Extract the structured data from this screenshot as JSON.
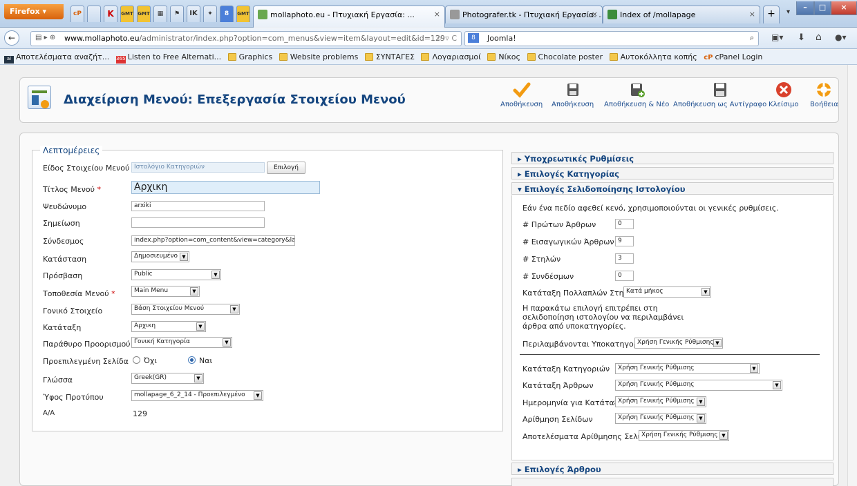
{
  "browser": {
    "firefox_label": "Firefox",
    "app_tabs": [
      "cP",
      "",
      "K",
      "GMT",
      "GMT",
      "",
      "",
      "IK",
      "",
      "8",
      "GMT"
    ],
    "tabs": [
      {
        "title": "mollaphoto.eu - Πτυχιακή Εργασία: ..."
      },
      {
        "title": "Photografer.tk - Πτυχιακή Εργασία: ..."
      },
      {
        "title": "Index of /mollapage"
      }
    ],
    "new_tab": "+",
    "url_host": "www.mollaphoto.eu",
    "url_path": "/administrator/index.php?option=com_menus&view=item&layout=edit&id=129",
    "search_text": "Joomla!",
    "bookmarks": [
      "Αποτελέσματα αναζήτ...",
      "Listen to Free Alternati...",
      "Graphics",
      "Website problems",
      "ΣΥΝΤΑΓΕΣ",
      "Λογαριασμοί",
      "Νίκος",
      "Chocolate poster",
      "Αυτοκόλλητα κοπής",
      "cPanel Login"
    ]
  },
  "page": {
    "title": "Διαχείριση Μενού: Επεξεργασία Στοιχείου Μενού",
    "toolbar": [
      "Αποθήκευση",
      "Αποθήκευση",
      "Αποθήκευση & Νέο",
      "Αποθήκευση ως Αντίγραφο",
      "Κλείσιμο",
      "Βοήθεια"
    ]
  },
  "details": {
    "legend": "Λεπτομέρειες",
    "fields": [
      {
        "label": "Είδος Στοιχείου Μενού",
        "value": "Ιστολόγιο Κατηγοριών",
        "button": "Επιλογή"
      },
      {
        "label": "Τίτλος Μενού",
        "value": "Αρχικη"
      },
      {
        "label": "Ψευδώνυμο",
        "value": "arxiki"
      },
      {
        "label": "Σημείωση",
        "value": ""
      },
      {
        "label": "Σύνδεσμος",
        "value": "index.php?option=com_content&view=category&layout="
      },
      {
        "label": "Κατάσταση",
        "value": "Δημοσιευμένο"
      },
      {
        "label": "Πρόσβαση",
        "value": "Public"
      },
      {
        "label": "Τοποθεσία Μενού",
        "value": "Main Menu"
      },
      {
        "label": "Γονικό Στοιχείο",
        "value": "Βάση Στοιχείου Μενού"
      },
      {
        "label": "Κατάταξη",
        "value": "Αρχικη"
      },
      {
        "label": "Παράθυρο Προορισμού",
        "value": "Γονική Κατηγορία"
      },
      {
        "label": "Προεπιλεγμένη Σελίδα",
        "option_no": "Όχι",
        "option_yes": "Ναι",
        "selected": "Ναι"
      },
      {
        "label": "Γλώσσα",
        "value": "Greek(GR)"
      },
      {
        "label": "Ύφος Προτύπου",
        "value": "mollapage_6_2_14 - Προεπιλεγμένο"
      },
      {
        "label": "Α/Α",
        "value": "129"
      }
    ]
  },
  "right": {
    "accordion": [
      "Υποχρεωτικές Ρυθμίσεις",
      "Επιλογές Κατηγορίας",
      "Επιλογές Σελιδοποίησης Ιστολογίου",
      "Επιλογές Άρθρου"
    ],
    "hint": "Εάν ένα πεδίο αφεθεί κενό, χρησιμοποιούνται οι γενικές ρυθμίσεις.",
    "numbers": [
      {
        "label": "# Πρώτων Άρθρων",
        "value": "0"
      },
      {
        "label": "# Εισαγωγικών Άρθρων",
        "value": "9"
      },
      {
        "label": "# Στηλών",
        "value": "3"
      },
      {
        "label": "# Συνδέσμων",
        "value": "0"
      }
    ],
    "multi_col": {
      "label": "Κατάταξη Πολλαπλών Στηλών",
      "value": "Κατά μήκος"
    },
    "subcat_note": [
      "Η παρακάτω επιλογή επιτρέπει στη",
      "σελιδοποίηση ιστολογίου να περιλαμβάνει",
      "άρθρα από υποκατηγορίες."
    ],
    "include_sub": {
      "label": "Περιλαμβάνονται Υποκατηγορίες",
      "value": "Χρήση Γενικής Ρύθμισης"
    },
    "ordering": [
      {
        "label": "Κατάταξη Κατηγοριών",
        "value": "Χρήση Γενικής Ρύθμισης"
      },
      {
        "label": "Κατάταξη Άρθρων",
        "value": "Χρήση Γενικής Ρύθμισης"
      },
      {
        "label": "Ημερομηνία για Κατάταξη",
        "value": "Χρήση Γενικής Ρύθμισης"
      },
      {
        "label": "Αρίθμηση Σελίδων",
        "value": "Χρήση Γενικής Ρύθμισης"
      },
      {
        "label": "Αποτελέσματα Αρίθμησης Σελίδων",
        "value": "Χρήση Γενικής Ρύθμισης"
      }
    ]
  }
}
